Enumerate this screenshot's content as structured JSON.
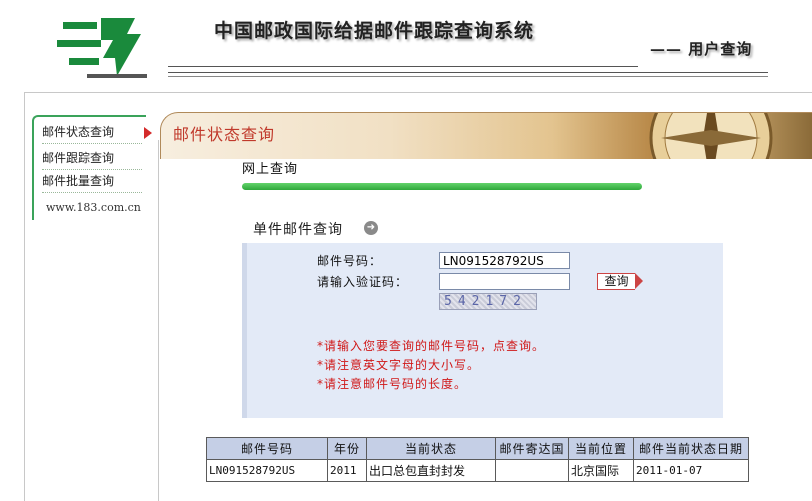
{
  "header": {
    "title": "中国邮政国际给据邮件跟踪查询系统",
    "subtitle": "—— 用户查询"
  },
  "sidebar": {
    "items": [
      {
        "label": "邮件状态查询"
      },
      {
        "label": "邮件跟踪查询"
      },
      {
        "label": "邮件批量查询"
      }
    ],
    "url": "www.183.com.cn"
  },
  "banner": {
    "title": "邮件状态查询"
  },
  "main": {
    "section_title": "网上查询",
    "query_title": "单件邮件查询",
    "form": {
      "mail_number_label": "邮件号码：",
      "mail_number_value": "LN091528792US",
      "captcha_label": "请输入验证码：",
      "captcha_value": "",
      "captcha_text": "542172",
      "submit_label": "查询"
    },
    "hints": [
      "*请输入您要查询的邮件号码，点查询。",
      "*请注意英文字母的大小写。",
      "*请注意邮件号码的长度。"
    ]
  },
  "result_table": {
    "headers": [
      "邮件号码",
      "年份",
      "当前状态",
      "邮件寄达国",
      "当前位置",
      "邮件当前状态日期"
    ],
    "rows": [
      [
        "LN091528792US",
        "2011",
        "出口总包直封封发",
        "",
        "北京国际",
        "2011-01-07"
      ]
    ]
  },
  "colors": {
    "accent_green": "#2ea83a",
    "hint_red": "#d01818",
    "panel_blue": "#e3eaf7",
    "table_header": "#c5cfe6"
  },
  "icons": [
    "china-post-logo-icon",
    "nav-arrow-icon",
    "circle-arrow-icon",
    "compass-icon"
  ]
}
